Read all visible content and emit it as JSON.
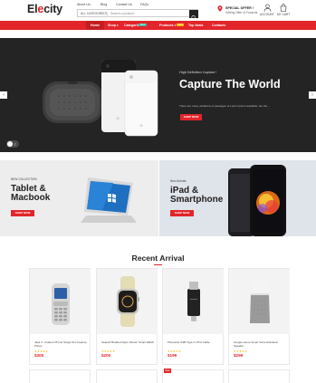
{
  "header": {
    "logo_text": "El",
    "logo_accent": "e",
    "logo_rest": "city",
    "top_links": [
      "About Us",
      "Blog",
      "Contact Us",
      "FAQs"
    ],
    "search": {
      "category": "ALL CATEGORIES",
      "placeholder": "Search a product..."
    },
    "offer_title": "SPECIAL OFFER !",
    "offer_sub": "Getting Offer of Products",
    "account_label": "ACCOUNT",
    "cart_label": "MY CART"
  },
  "nav": {
    "items": [
      "Home",
      "Shop",
      "Categories",
      "Products",
      "Top deals",
      "Contacts"
    ],
    "categories_badge": "NEW",
    "products_badge": "HOT"
  },
  "hero": {
    "tag": "High Definition Capture !",
    "title": "Capture The World",
    "desc": "There are many variations of passages of Lorem Ipsum available, but the...",
    "button": "SHOP NOW",
    "prev": "‹",
    "next": "›"
  },
  "banners": [
    {
      "subtitle": "NEW COLLECTION",
      "title_line1": "Tablet &",
      "title_line2": "Macbook",
      "button": "SHOP NOW"
    },
    {
      "subtitle": "New Arrivals",
      "title_line1": "iPad &",
      "title_line2": "Smartphone",
      "button": "SHOP NOW"
    }
  ],
  "recent": {
    "title": "Recent Arrival",
    "products": [
      {
        "name": "Jaipi 3 - Feature Phone Single Sim Feature Phone",
        "price": "$300",
        "stars": "★★★★★"
      },
      {
        "name": "Seapeft Braided Nylon Woven Smart Watch",
        "price": "$200",
        "stars": "★★★★★"
      },
      {
        "name": "Phonelink USB Type-C OTG Cable",
        "price": "$199",
        "stars": "★★★★★"
      },
      {
        "name": "Google Home Smart Voice Activated Speaker",
        "price": "$299",
        "stars": "★★★★★"
      }
    ],
    "sale_tag": "Sale"
  },
  "colors": {
    "brand_red": "#e2252a",
    "hero_bg": "#242424",
    "star": "#f5b400"
  },
  "icons": [
    "search-icon",
    "location-pin-icon",
    "user-icon",
    "cart-icon",
    "chevron-left-icon",
    "chevron-right-icon",
    "moon-icon"
  ]
}
